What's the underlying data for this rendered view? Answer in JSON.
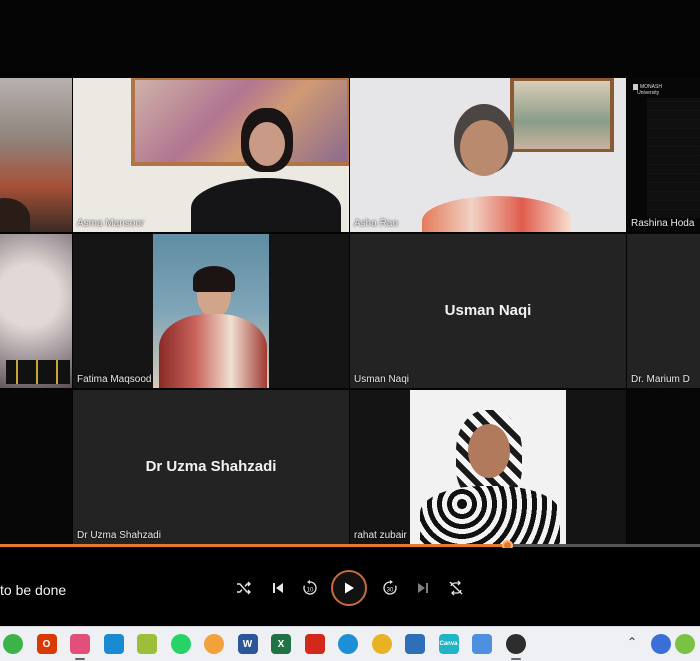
{
  "participants": [
    {
      "id": "left-top",
      "name": ""
    },
    {
      "id": "asma",
      "name": "Asma Mansoor"
    },
    {
      "id": "asha",
      "name": "Asha Rao"
    },
    {
      "id": "rashina",
      "name": "Rashina Hoda",
      "logo": "MONASH University"
    },
    {
      "id": "left-mid",
      "name": ""
    },
    {
      "id": "fatima",
      "name": "Fatima Maqsood"
    },
    {
      "id": "usman",
      "name": "Usman Naqi",
      "big_label": "Usman Naqi"
    },
    {
      "id": "marium",
      "name": "Dr. Marium D"
    },
    {
      "id": "uzma",
      "name": "Dr Uzma Shahzadi",
      "big_label": "Dr Uzma Shahzadi"
    },
    {
      "id": "rahat",
      "name": "rahat zubair"
    }
  ],
  "player": {
    "title": "to be done",
    "progress": 0.724,
    "controls": [
      "shuffle-icon",
      "previous-icon",
      "rewind-10-icon",
      "play-icon",
      "forward-30-icon",
      "next-icon",
      "repeat-off-icon"
    ],
    "rewind_label": "10",
    "forward_label": "30"
  },
  "taskbar": {
    "apps": [
      {
        "name": "whatsapp-like-icon",
        "color": "#3bb34a",
        "label": ""
      },
      {
        "name": "office-icon",
        "color": "#d83b01",
        "label": "O"
      },
      {
        "name": "snipping-tool-icon",
        "color": "#e14f7a",
        "label": ""
      },
      {
        "name": "photos-icon",
        "color": "#1a8ad3",
        "label": ""
      },
      {
        "name": "notepad-icon",
        "color": "#9bbf3a",
        "label": ""
      },
      {
        "name": "whatsapp-icon",
        "color": "#25d366",
        "label": ""
      },
      {
        "name": "chrome-canary-icon",
        "color": "#f3a23b",
        "label": ""
      },
      {
        "name": "word-icon",
        "color": "#2b579a",
        "label": "W"
      },
      {
        "name": "excel-icon",
        "color": "#217346",
        "label": "X"
      },
      {
        "name": "acrobat-icon",
        "color": "#d4281c",
        "label": ""
      },
      {
        "name": "edge-icon",
        "color": "#1d8fd6",
        "label": ""
      },
      {
        "name": "chrome-icon",
        "color": "#e8b323",
        "label": ""
      },
      {
        "name": "mail-icon",
        "color": "#2f6fb7",
        "label": ""
      },
      {
        "name": "canva-icon",
        "color": "#20b4c7",
        "label": "Canva"
      },
      {
        "name": "paint-icon",
        "color": "#4f8fe0",
        "label": ""
      },
      {
        "name": "media-player-icon",
        "color": "#2d2d2d",
        "label": ""
      }
    ],
    "tray": [
      "chevron-up-icon",
      "meet-icon",
      "whatsapp-tray-icon"
    ]
  },
  "colors": {
    "accent": "#e07a2d",
    "stage": "#050505",
    "taskbar": "#eef0f4"
  }
}
